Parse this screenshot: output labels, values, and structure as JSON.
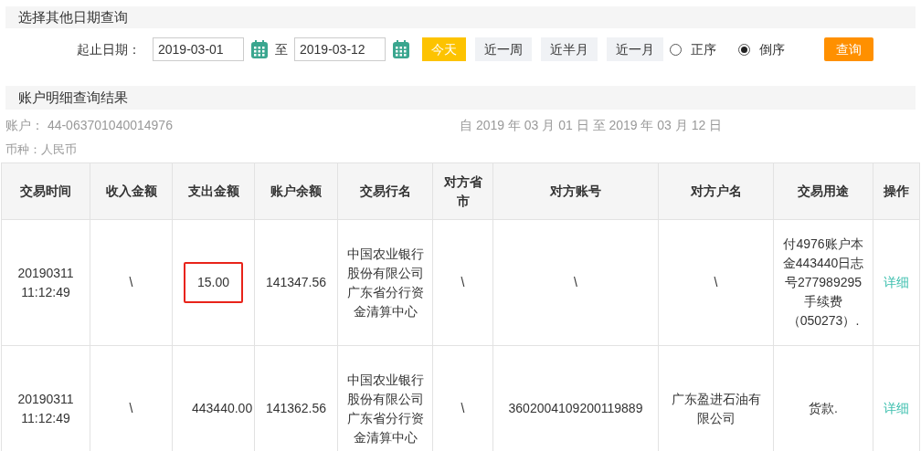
{
  "query_section": {
    "title": "选择其他日期查询",
    "date_label": "起止日期：",
    "start_date": "2019-03-01",
    "separator": "至",
    "end_date": "2019-03-12",
    "quick_ranges": [
      {
        "label": "今天",
        "selected": true
      },
      {
        "label": "近一周",
        "selected": false
      },
      {
        "label": "近半月",
        "selected": false
      },
      {
        "label": "近一月",
        "selected": false
      }
    ],
    "sort_options": [
      {
        "label": "正序",
        "selected": false
      },
      {
        "label": "倒序",
        "selected": true
      }
    ],
    "query_button": "查询"
  },
  "result_section": {
    "title": "账户明细查询结果",
    "account": "账户： 44-063701040014976",
    "period": "自 2019 年 03 月 01 日 至 2019 年 03 月 12 日",
    "currency": "币种：人民币"
  },
  "table": {
    "columns": [
      "交易时间",
      "收入金额",
      "支出金额",
      "账户余额",
      "交易行名",
      "对方省市",
      "对方账号",
      "对方户名",
      "交易用途",
      "操作"
    ],
    "rows": [
      {
        "time": "20190311 11:12:49",
        "income": "\\",
        "expense": "15.00",
        "expense_highlighted": true,
        "balance": "141347.56",
        "bank": "中国农业银行股份有限公司广东省分行资金清算中心",
        "province": "\\",
        "account": "\\",
        "name": "\\",
        "purpose": "付4976账户本金443440日志号277989295手续费（050273）.",
        "action": "详细"
      },
      {
        "time": "20190311 11:12:49",
        "income": "\\",
        "expense": "443440.00",
        "expense_highlighted": false,
        "balance": "141362.56",
        "bank": "中国农业银行股份有限公司广东省分行资金清算中心",
        "province": "\\",
        "account": "3602004109200119889",
        "name": "广东盈进石油有限公司",
        "purpose": "货款.",
        "action": "详细"
      }
    ]
  }
}
